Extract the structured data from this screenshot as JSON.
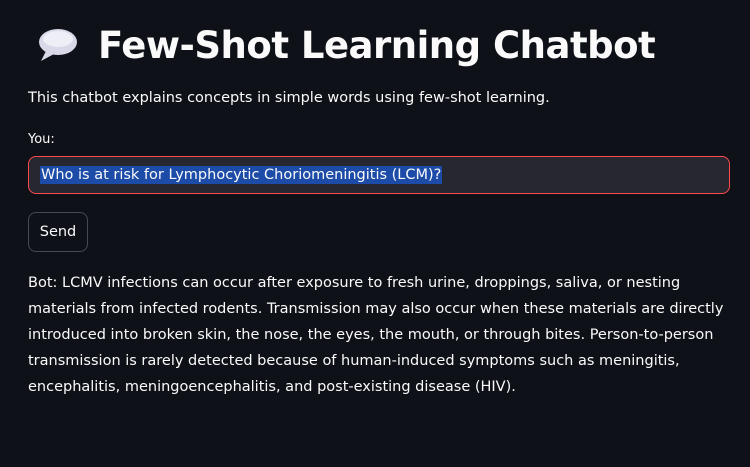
{
  "header": {
    "icon": "speech-balloon-icon",
    "title": "Few-Shot Learning Chatbot"
  },
  "description": "This chatbot explains concepts in simple words using few-shot learning.",
  "input": {
    "label": "You:",
    "value": "Who is at risk for Lymphocytic Choriomeningitis (LCM)?"
  },
  "send_button": {
    "label": "Send"
  },
  "response": {
    "text": "Bot: LCMV infections can occur after exposure to fresh urine, droppings, saliva, or nesting materials from infected rodents. Transmission may also occur when these materials are directly introduced into broken skin, the nose, the eyes, the mouth, or through bites. Person-to-person transmission is rarely detected because of human-induced symptoms such as meningitis, encephalitis, meningoencephalitis, and post-existing disease (HIV)."
  },
  "colors": {
    "background": "#0e1117",
    "text": "#fafafa",
    "input_background": "#262730",
    "input_border_focus": "#ff4b4b",
    "selection": "#1c4ba8",
    "button_border": "#474955"
  }
}
